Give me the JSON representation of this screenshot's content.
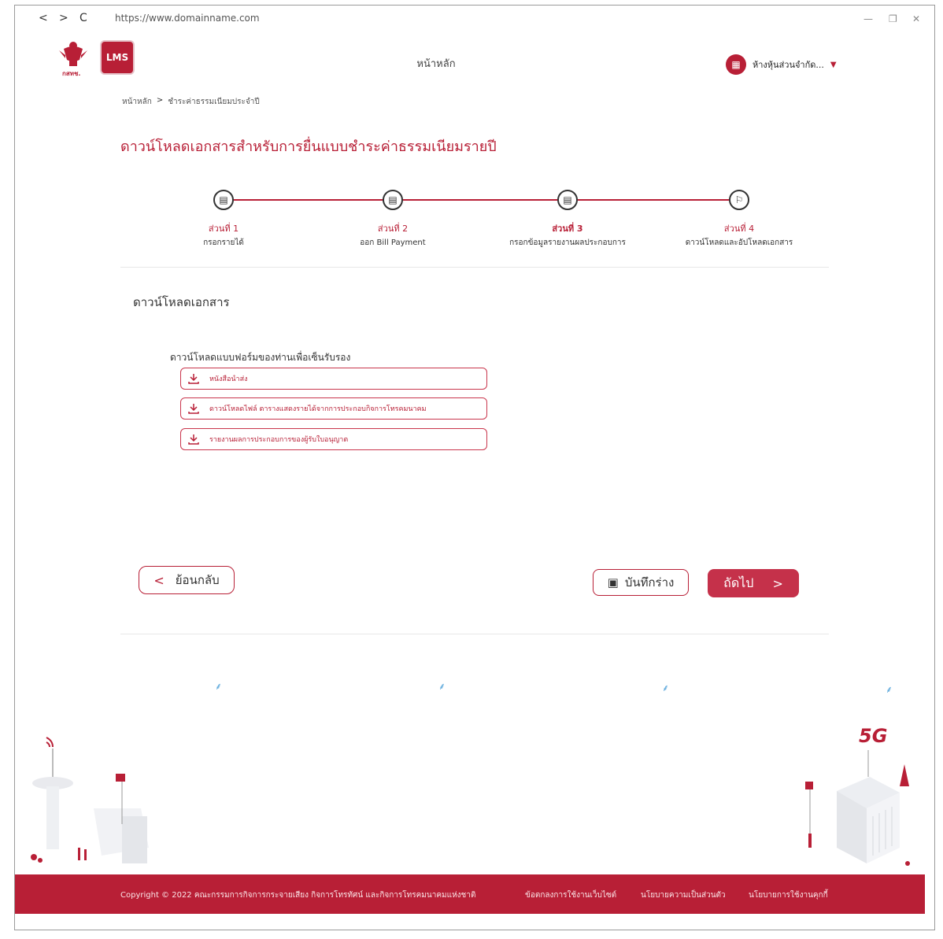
{
  "browser": {
    "url": "https://www.domainname.com",
    "back": "<",
    "forward": ">",
    "reload": "C"
  },
  "header": {
    "title": "หน้าหลัก",
    "user_name": "ห้างหุ้นส่วนจำกัด...",
    "garuda_caption": "กสทช.",
    "lms_logo": "LMS"
  },
  "breadcrumb": {
    "home": "หน้าหลัก",
    "separator": ">",
    "current": "ชำระค่าธรรมเนียมประจำปี"
  },
  "page_title": "ดาวน์โหลดเอกสารสำหรับการยื่นแบบชำระค่าธรรมเนียมรายปี",
  "steps": [
    {
      "title": "ส่วนที่ 1",
      "desc": "กรอกรายได้",
      "icon": "document-icon"
    },
    {
      "title": "ส่วนที่ 2",
      "desc": "ออก Bill Payment",
      "icon": "document-icon"
    },
    {
      "title": "ส่วนที่ 3",
      "desc": "กรอกข้อมูลรายงานผลประกอบการ",
      "icon": "document-icon"
    },
    {
      "title": "ส่วนที่ 4",
      "desc": "ดาวน์โหลดและอัปโหลดเอกสาร",
      "icon": "flag-icon"
    }
  ],
  "section": {
    "title": "ดาวน์โหลดเอกสาร",
    "subtitle": "ดาวน์โหลดแบบฟอร์มของท่านเพื่อเซ็นรับรอง",
    "downloads": [
      "หนังสือนำส่ง",
      "ดาวน์โหลดไฟล์ ตารางแสดงรายได้จากการประกอบกิจการโทรคมนาคม",
      "รายงานผลการประกอบการของผู้รับใบอนุญาต"
    ]
  },
  "buttons": {
    "back": "ย้อนกลับ",
    "save_draft": "บันทึกร่าง",
    "next": "ถัดไป"
  },
  "illustration": {
    "fiveg": "5G"
  },
  "footer": {
    "copyright": "Copyright © 2022 คณะกรรมการกิจการกระจายเสียง กิจการโทรทัศน์ และกิจการโทรคมนาคมแห่งชาติ",
    "terms": "ข้อตกลงการใช้งานเว็บไซต์",
    "privacy": "นโยบายความเป็นส่วนตัว",
    "cookies": "นโยบายการใช้งานคุกกี้"
  },
  "colors": {
    "accent": "#b81f36",
    "next_button": "#c5314a"
  }
}
